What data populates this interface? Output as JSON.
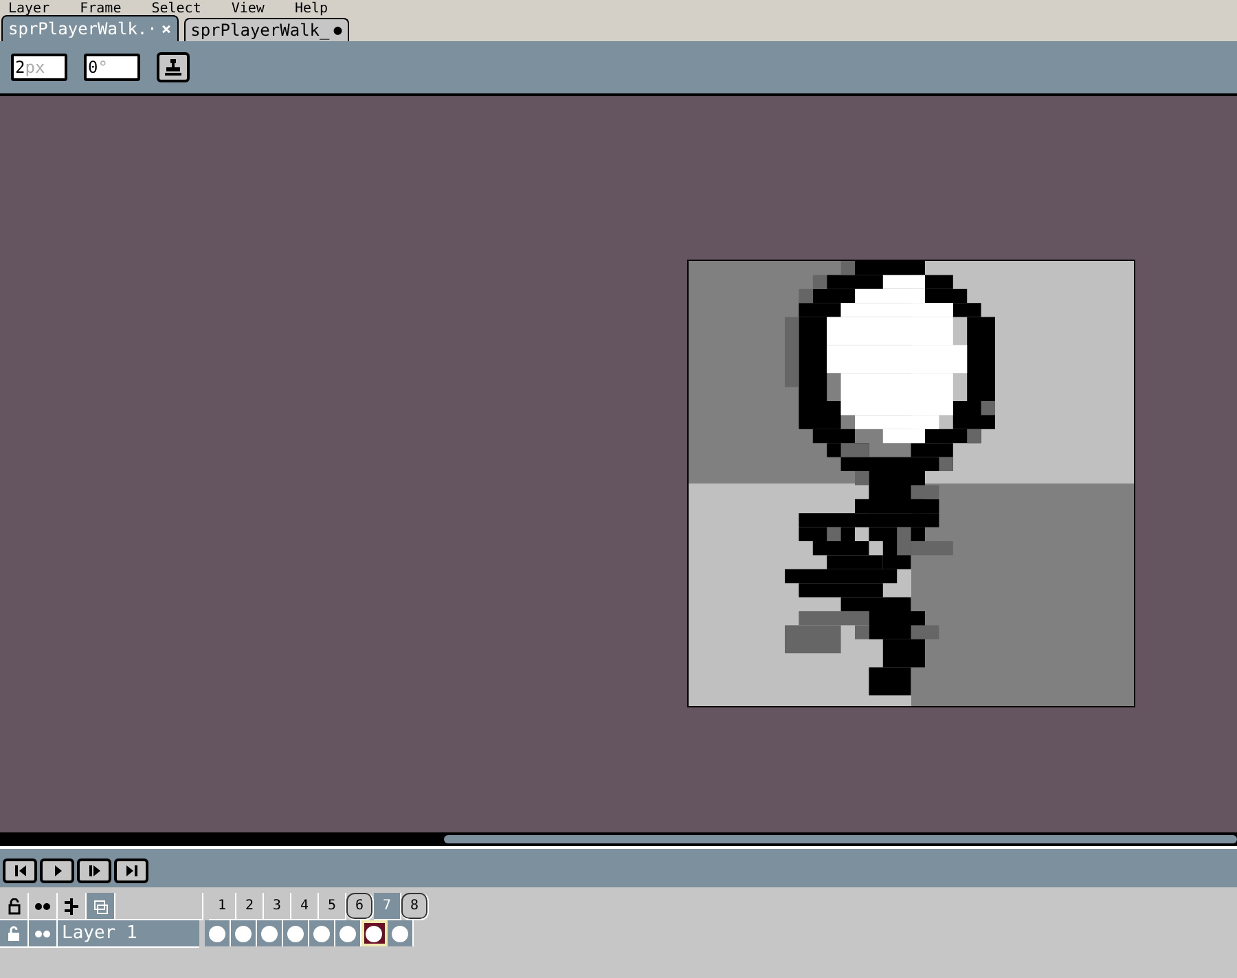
{
  "menu": [
    "Layer",
    "Frame",
    "Select",
    "View",
    "Help"
  ],
  "tabs": [
    {
      "label": "sprPlayerWalk.·",
      "selected": true,
      "kind": "close",
      "mark": "×"
    },
    {
      "label": "sprPlayerWalk_",
      "selected": false,
      "kind": "modified",
      "mark": "●"
    }
  ],
  "toolbar": {
    "fields": [
      {
        "value": "2",
        "unit": "px"
      },
      {
        "value": "0",
        "unit": "°"
      }
    ]
  },
  "timeline": {
    "frames": [
      {
        "label": "1",
        "selected": false,
        "tagged": false
      },
      {
        "label": "2",
        "selected": false,
        "tagged": false
      },
      {
        "label": "3",
        "selected": false,
        "tagged": false
      },
      {
        "label": "4",
        "selected": false,
        "tagged": false
      },
      {
        "label": "5",
        "selected": false,
        "tagged": false
      },
      {
        "label": "6",
        "selected": false,
        "tagged": true
      },
      {
        "label": "7",
        "selected": true,
        "tagged": false
      },
      {
        "label": "8",
        "selected": false,
        "tagged": true
      }
    ],
    "layers": [
      {
        "name": "Layer 1"
      }
    ]
  }
}
